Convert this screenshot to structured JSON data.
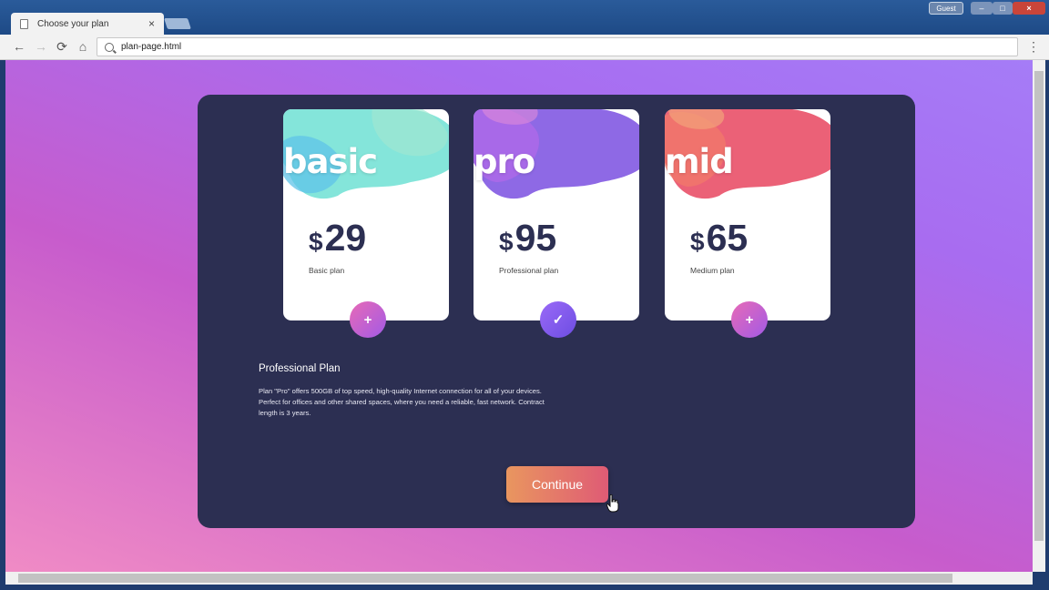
{
  "browser": {
    "tab_title": "Choose your plan",
    "tab_close": "×",
    "url": "plan-page.html",
    "profile_label": "Guest",
    "window_controls": {
      "minimize": "–",
      "maximize": "□",
      "close": "×"
    },
    "nav_glyphs": {
      "back": "←",
      "forward": "→",
      "reload": "⟳",
      "home": "⌂",
      "menu": "⋮"
    }
  },
  "plans": [
    {
      "name": "basic",
      "currency": "$",
      "price": "29",
      "subtitle": "Basic plan",
      "selected": false,
      "button_glyph": "+",
      "splash_colors": [
        "#6fe0d3",
        "#5fc3e8",
        "#9fe7d2"
      ]
    },
    {
      "name": "pro",
      "currency": "$",
      "price": "95",
      "subtitle": "Professional plan",
      "selected": true,
      "button_glyph": "✓",
      "splash_colors": [
        "#7a4fe0",
        "#b06ae8",
        "#e08ad8"
      ]
    },
    {
      "name": "mid",
      "currency": "$",
      "price": "65",
      "subtitle": "Medium plan",
      "selected": false,
      "button_glyph": "+",
      "splash_colors": [
        "#e8455f",
        "#f27a6a",
        "#f2a27a"
      ]
    }
  ],
  "description": {
    "title": "Professional Plan",
    "body": "Plan \"Pro\" offers 500GB of top speed, high-quality Internet connection for all of your devices. Perfect for offices and other shared spaces, where you need a reliable, fast network. Contract length is 3 years."
  },
  "continue_label": "Continue",
  "colors": {
    "panel": "#2c2f52",
    "accent_gradient": [
      "#e9965f",
      "#df5b75"
    ],
    "background_gradient": [
      "#f08bc5",
      "#a57cf7"
    ]
  }
}
